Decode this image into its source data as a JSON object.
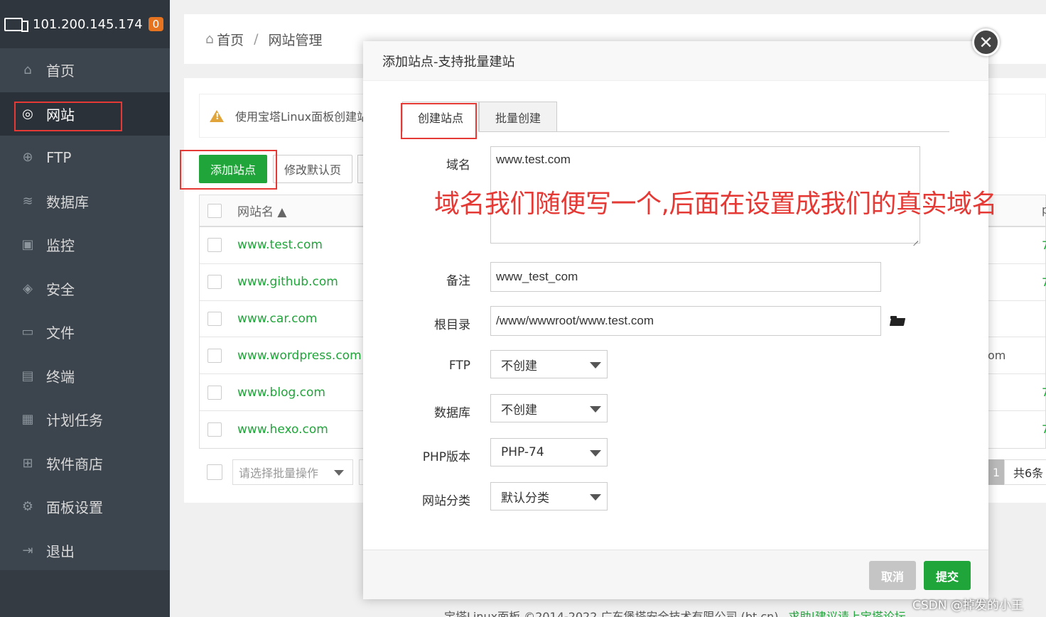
{
  "sidebar": {
    "ip": "101.200.145.174",
    "badge": "0",
    "items": [
      {
        "label": "首页",
        "icon": "home-icon"
      },
      {
        "label": "网站",
        "icon": "globe-icon"
      },
      {
        "label": "FTP",
        "icon": "ftp-icon"
      },
      {
        "label": "数据库",
        "icon": "database-icon"
      },
      {
        "label": "监控",
        "icon": "monitor-icon"
      },
      {
        "label": "安全",
        "icon": "shield-icon"
      },
      {
        "label": "文件",
        "icon": "folder-icon"
      },
      {
        "label": "终端",
        "icon": "terminal-icon"
      },
      {
        "label": "计划任务",
        "icon": "calendar-icon"
      },
      {
        "label": "软件商店",
        "icon": "apps-icon"
      },
      {
        "label": "面板设置",
        "icon": "gear-icon"
      },
      {
        "label": "退出",
        "icon": "logout-icon"
      }
    ]
  },
  "breadcrumb": {
    "home": "首页",
    "sep": "/",
    "current": "网站管理"
  },
  "notice": "使用宝塔Linux面板创建站",
  "toolbar": {
    "add_site": "添加站点",
    "modify_default": "修改默认页"
  },
  "table": {
    "header": "网站名 ▲",
    "rows": [
      "www.test.com",
      "www.github.com",
      "www.car.com",
      "www.wordpress.com",
      "www.blog.com",
      "www.hexo.com"
    ],
    "right_fragments": [
      "p",
      "7",
      "7",
      "om",
      "7",
      "7",
      "7"
    ]
  },
  "batch": {
    "placeholder": "请选择批量操作"
  },
  "pager": {
    "page": "1",
    "total": "共6条"
  },
  "footer": {
    "text": "宝塔Linux面板 ©2014-2022 广东堡塔安全技术有限公司 (bt.cn)",
    "link": "求助|建议请上宝塔论坛"
  },
  "modal": {
    "title": "添加站点-支持批量建站",
    "tabs": [
      "创建站点",
      "批量创建"
    ],
    "fields": {
      "domain_label": "域名",
      "domain_value": "www.test.com",
      "remark_label": "备注",
      "remark_value": "www_test_com",
      "root_label": "根目录",
      "root_value": "/www/wwwroot/www.test.com",
      "ftp_label": "FTP",
      "ftp_value": "不创建",
      "db_label": "数据库",
      "db_value": "不创建",
      "php_label": "PHP版本",
      "php_value": "PHP-74",
      "cat_label": "网站分类",
      "cat_value": "默认分类"
    },
    "cancel": "取消",
    "submit": "提交"
  },
  "annotation": "域名我们随便写一个,后面在设置成我们的真实域名",
  "watermark": "CSDN @掉发的小王",
  "colors": {
    "accent": "#20a53a",
    "annotation": "#e53935",
    "sidebar": "#3c444d"
  }
}
